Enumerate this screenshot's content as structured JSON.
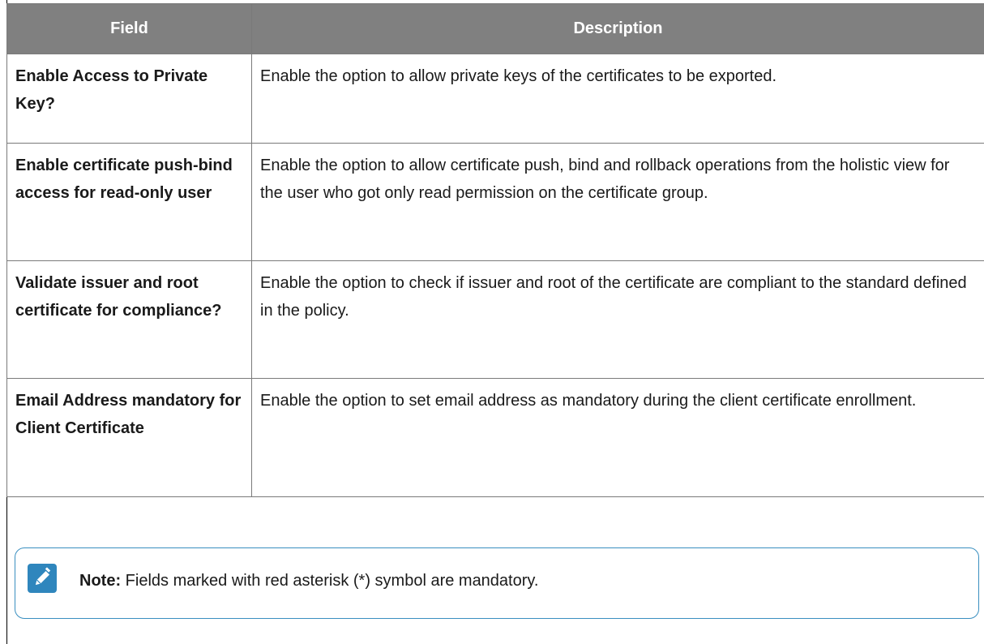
{
  "table": {
    "headers": {
      "field": "Field",
      "description": "Description"
    },
    "rows": [
      {
        "field": "Enable Access to Private Key?",
        "description": "Enable the option to allow private keys of the certificates to be exported."
      },
      {
        "field": "Enable certificate push-bind access for read-only user",
        "description": "Enable the option to allow certificate push, bind and rollback operations from the holistic view for the user who got only read permission on the certificate group."
      },
      {
        "field": "Validate issuer and root certificate for compliance?",
        "description": "Enable the option to check if issuer and root of the certificate are compliant to the standard defined in the policy."
      },
      {
        "field": "Email Address mandatory for Client Certificate",
        "description": "Enable the option to set email address as mandatory during the client certificate enrollment."
      }
    ]
  },
  "note": {
    "icon": "pencil-note-icon",
    "label": "Note:",
    "text": "Fields marked with red asterisk (*) symbol are mandatory."
  },
  "colors": {
    "header_bg": "#808080",
    "header_text": "#ffffff",
    "note_border": "#3a8fc0",
    "note_icon_bg": "#2f86bd"
  }
}
